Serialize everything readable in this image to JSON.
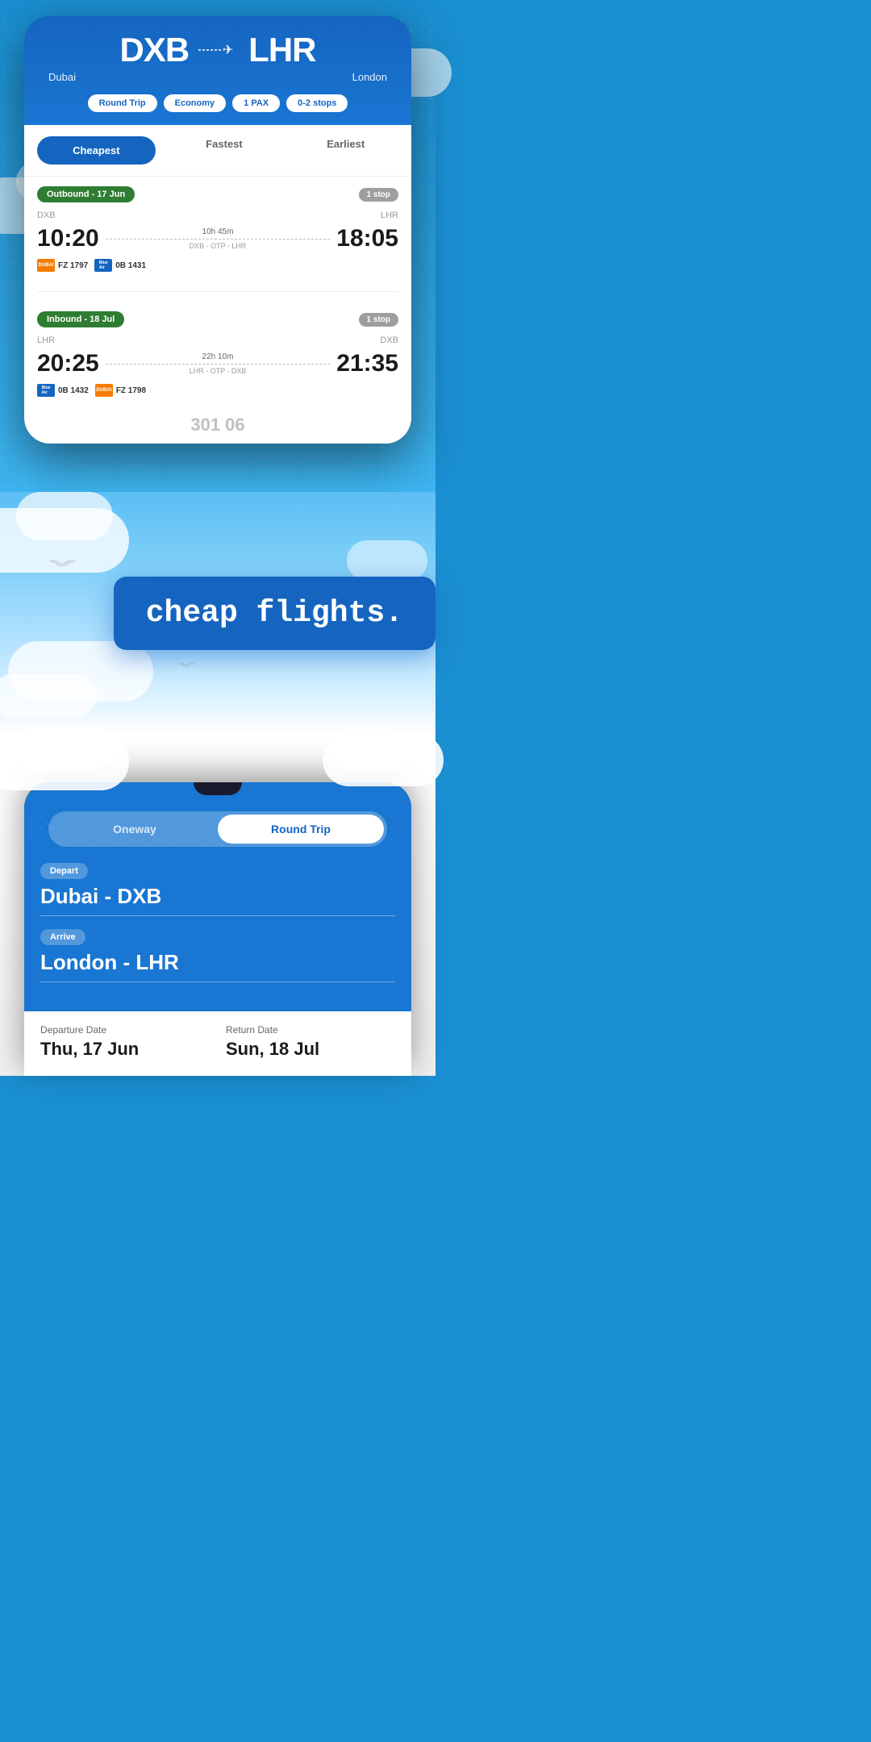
{
  "topPhone": {
    "route": {
      "from_code": "DXB",
      "to_code": "LHR",
      "from_city": "Dubai",
      "to_city": "London",
      "plane_symbol": "✈"
    },
    "filters": {
      "trip_type": "Round Trip",
      "cabin": "Economy",
      "passengers": "1 PAX",
      "stops": "0-2 stops"
    },
    "tabs": {
      "cheapest": "Cheapest",
      "fastest": "Fastest",
      "earliest": "Earliest",
      "active": "cheapest"
    },
    "outbound": {
      "label": "Outbound - 17 Jun",
      "stops": "1 stop",
      "from": "DXB",
      "to": "LHR",
      "depart_time": "10:20",
      "arrive_time": "18:05",
      "duration": "10h 45m",
      "route_path": "DXB - OTP - LHR",
      "airline1_code": "FZ 1797",
      "airline1_name": "dubai",
      "airline2_code": "0B 1431",
      "airline2_name": "blue"
    },
    "inbound": {
      "label": "Inbound - 18 Jul",
      "stops": "1 stop",
      "from": "LHR",
      "to": "DXB",
      "depart_time": "20:25",
      "arrive_time": "21:35",
      "duration": "22h 10m",
      "route_path": "LHR - OTP - DXB",
      "airline1_code": "0B 1432",
      "airline1_name": "blue",
      "airline2_code": "FZ 1798",
      "airline2_name": "dubai"
    },
    "price_peek": "301 06"
  },
  "middle": {
    "tagline": "cheap flights."
  },
  "bottomPhone": {
    "toggle": {
      "oneway": "Oneway",
      "round_trip": "Round Trip",
      "active": "round_trip"
    },
    "depart_label": "Depart",
    "depart_value": "Dubai - DXB",
    "arrive_label": "Arrive",
    "arrive_value": "London - LHR",
    "departure_date_label": "Departure Date",
    "departure_date_value": "Thu, 17 Jun",
    "return_date_label": "Return Date",
    "return_date_value": "Sun, 18 Jul"
  }
}
